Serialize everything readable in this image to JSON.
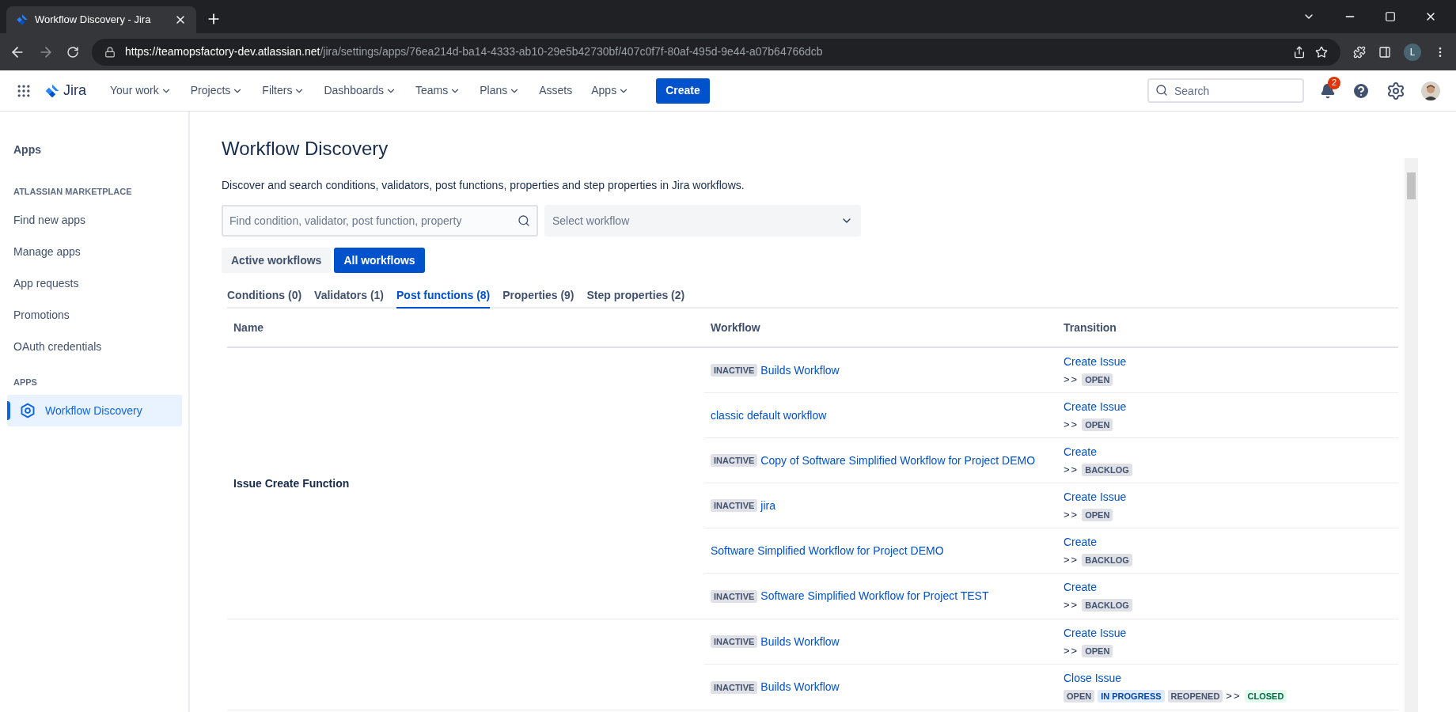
{
  "browser": {
    "tab_title": "Workflow Discovery - Jira",
    "url_host": "https://teamopsfactory-dev.atlassian.net",
    "url_path": "/jira/settings/apps/76ea214d-ba14-4333-ab10-29e5b42730bf/407c0f7f-80af-495d-9e44-a07b64766dcb",
    "profile_initial": "L"
  },
  "topnav": {
    "product": "Jira",
    "items": [
      {
        "label": "Your work",
        "dropdown": true
      },
      {
        "label": "Projects",
        "dropdown": true
      },
      {
        "label": "Filters",
        "dropdown": true
      },
      {
        "label": "Dashboards",
        "dropdown": true
      },
      {
        "label": "Teams",
        "dropdown": true
      },
      {
        "label": "Plans",
        "dropdown": true
      },
      {
        "label": "Assets",
        "dropdown": false
      },
      {
        "label": "Apps",
        "dropdown": true
      }
    ],
    "create": "Create",
    "search": {
      "placeholder": "Search"
    },
    "notifications": "2"
  },
  "sidebar": {
    "title": "Apps",
    "sections": [
      {
        "heading": "ATLASSIAN MARKETPLACE",
        "items": [
          {
            "label": "Find new apps",
            "selected": false
          },
          {
            "label": "Manage apps",
            "selected": false
          },
          {
            "label": "App requests",
            "selected": false
          },
          {
            "label": "Promotions",
            "selected": false
          },
          {
            "label": "OAuth credentials",
            "selected": false
          }
        ]
      },
      {
        "heading": "APPS",
        "items": [
          {
            "label": "Workflow Discovery",
            "selected": true,
            "icon": true
          }
        ]
      }
    ]
  },
  "page": {
    "title": "Workflow Discovery",
    "description": "Discover and search conditions, validators, post functions, properties and step properties in Jira workflows.",
    "search": {
      "placeholder": "Find condition, validator, post function, property"
    },
    "select": {
      "placeholder": "Select workflow"
    },
    "toggles": [
      {
        "label": "Active workflows",
        "selected": false
      },
      {
        "label": "All workflows",
        "selected": true
      }
    ],
    "tabs": [
      {
        "label": "Conditions (0)",
        "selected": false
      },
      {
        "label": "Validators (1)",
        "selected": false
      },
      {
        "label": "Post functions (8)",
        "selected": true
      },
      {
        "label": "Properties (9)",
        "selected": false
      },
      {
        "label": "Step properties (2)",
        "selected": false
      }
    ],
    "table": {
      "columns": [
        "Name",
        "Workflow",
        "Transition"
      ],
      "groups": [
        {
          "name": "Issue Create Function",
          "rows": [
            {
              "workflow": {
                "badge": "INACTIVE",
                "name": "Builds Workflow"
              },
              "transition": {
                "name": "Create Issue",
                "arrow": ">>",
                "to": {
                  "label": "OPEN",
                  "kind": "default"
                }
              }
            },
            {
              "workflow": {
                "name": "classic default workflow"
              },
              "transition": {
                "name": "Create Issue",
                "arrow": ">>",
                "to": {
                  "label": "OPEN",
                  "kind": "default"
                }
              }
            },
            {
              "workflow": {
                "badge": "INACTIVE",
                "name": "Copy of Software Simplified Workflow for Project DEMO"
              },
              "transition": {
                "name": "Create",
                "arrow": ">>",
                "to": {
                  "label": "BACKLOG",
                  "kind": "default"
                }
              }
            },
            {
              "workflow": {
                "badge": "INACTIVE",
                "name": "jira"
              },
              "transition": {
                "name": "Create Issue",
                "arrow": ">>",
                "to": {
                  "label": "OPEN",
                  "kind": "default"
                }
              }
            },
            {
              "workflow": {
                "name": "Software Simplified Workflow for Project DEMO"
              },
              "transition": {
                "name": "Create",
                "arrow": ">>",
                "to": {
                  "label": "BACKLOG",
                  "kind": "default"
                }
              }
            },
            {
              "workflow": {
                "badge": "INACTIVE",
                "name": "Software Simplified Workflow for Project TEST"
              },
              "transition": {
                "name": "Create",
                "arrow": ">>",
                "to": {
                  "label": "BACKLOG",
                  "kind": "default"
                }
              }
            }
          ]
        },
        {
          "rows": [
            {
              "workflow": {
                "badge": "INACTIVE",
                "name": "Builds Workflow"
              },
              "transition": {
                "name": "Create Issue",
                "arrow": ">>",
                "to": {
                  "label": "OPEN",
                  "kind": "default"
                }
              }
            },
            {
              "workflow": {
                "badge": "INACTIVE",
                "name": "Builds Workflow"
              },
              "transition": {
                "name": "Close Issue",
                "from": [
                  {
                    "label": "OPEN",
                    "kind": "default"
                  },
                  {
                    "label": "IN PROGRESS",
                    "kind": "inprogress"
                  },
                  {
                    "label": "REOPENED",
                    "kind": "default"
                  }
                ],
                "arrow": ">>",
                "to": {
                  "label": "CLOSED",
                  "kind": "success"
                }
              }
            }
          ]
        }
      ]
    }
  }
}
